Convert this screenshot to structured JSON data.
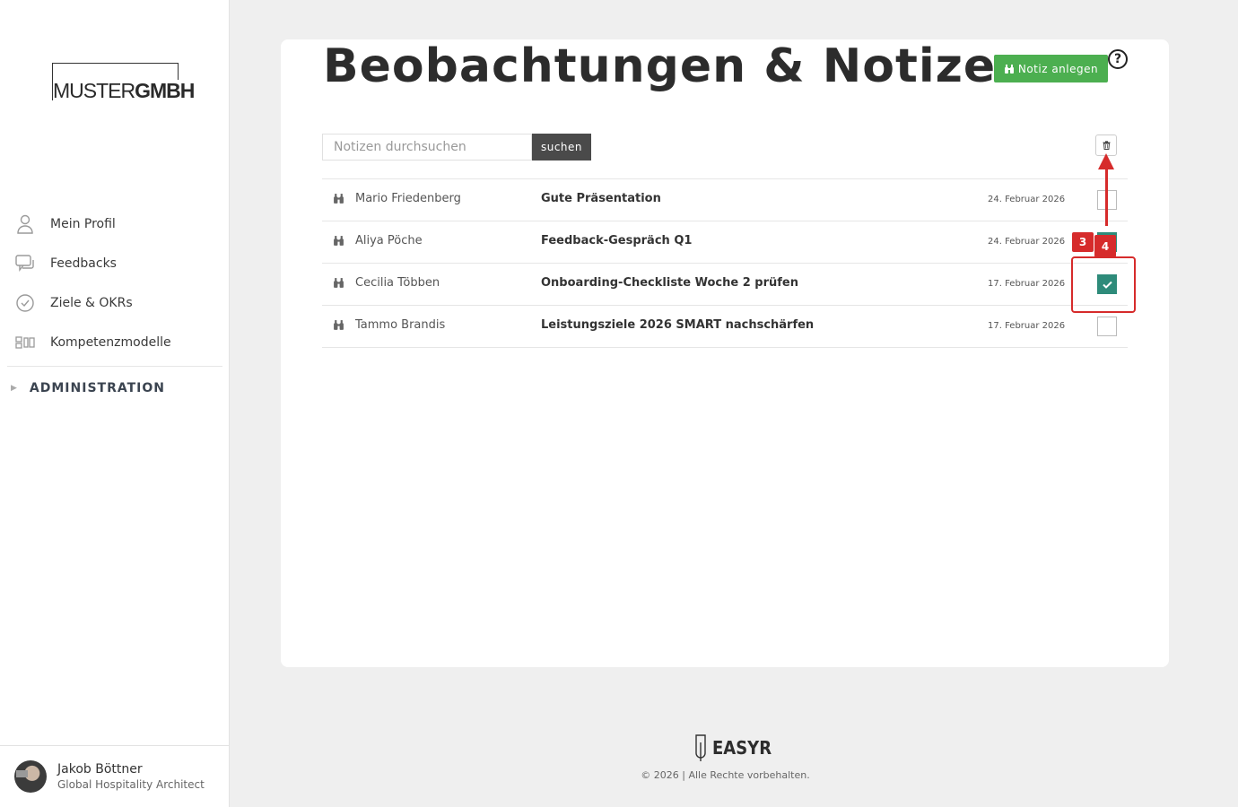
{
  "brand": {
    "logo_part1": "MUSTER",
    "logo_part2": "GMBH"
  },
  "sidebar": {
    "items": [
      {
        "label": "Mein Profil",
        "icon": "user-icon"
      },
      {
        "label": "Feedbacks",
        "icon": "chat-icon"
      },
      {
        "label": "Ziele & OKRs",
        "icon": "check-circle-icon"
      },
      {
        "label": "Kompetenzmodelle",
        "icon": "grid-icon"
      }
    ],
    "admin_label": "ADMINISTRATION"
  },
  "user": {
    "name": "Jakob Böttner",
    "role": "Global Hospitality Architect"
  },
  "main": {
    "title": "Beobachtungen & Notizen",
    "new_button_label": "Notiz anlegen",
    "help_label": "?",
    "search_placeholder": "Notizen durchsuchen",
    "search_button_label": "suchen",
    "notes": [
      {
        "author": "Mario Friedenberg",
        "title": "Gute Präsentation",
        "date": "24. Februar 2026",
        "checked": false
      },
      {
        "author": "Aliya Pöche",
        "title": "Feedback-Gespräch Q1",
        "date": "24. Februar 2026",
        "checked": true
      },
      {
        "author": "Cecilia Többen",
        "title": "Onboarding-Checkliste Woche 2 prüfen",
        "date": "17. Februar 2026",
        "checked": true
      },
      {
        "author": "Tammo Brandis",
        "title": "Leistungsziele 2026 SMART nachschärfen",
        "date": "17. Februar 2026",
        "checked": false
      }
    ]
  },
  "annotations": {
    "badge_a": "3",
    "badge_b": "4",
    "color": "#d62b2b"
  },
  "footer": {
    "logo_word": "EASYR",
    "copyright": "© 2026 | Alle Rechte vorbehalten."
  },
  "colors": {
    "primary_green": "#4caf50",
    "check_teal": "#2e8b7a",
    "search_button": "#4a4a4a"
  }
}
